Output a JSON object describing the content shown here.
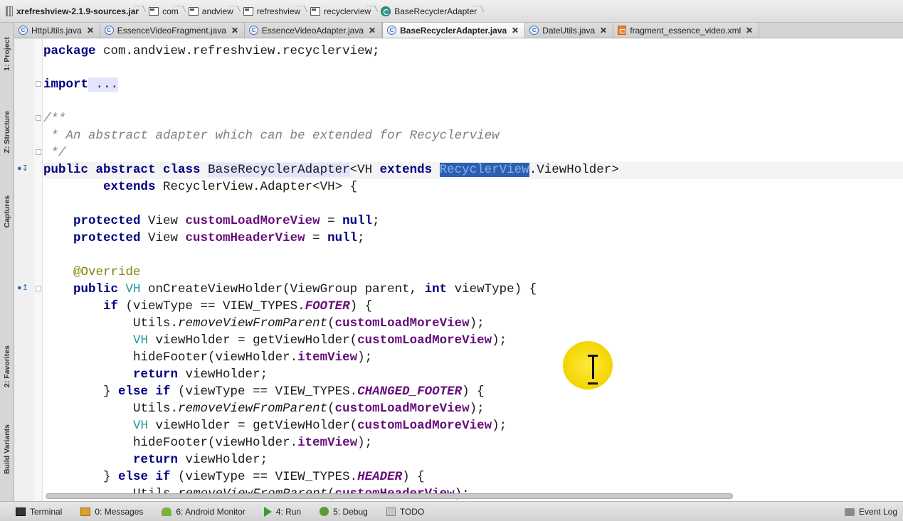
{
  "breadcrumb": [
    {
      "label": "xrefreshview-2.1.9-sources.jar",
      "icon": "jar-icon"
    },
    {
      "label": "com",
      "icon": "package-icon"
    },
    {
      "label": "andview",
      "icon": "package-icon"
    },
    {
      "label": "refreshview",
      "icon": "package-icon"
    },
    {
      "label": "recyclerview",
      "icon": "package-icon"
    },
    {
      "label": "BaseRecyclerAdapter",
      "icon": "class-icon"
    }
  ],
  "tabs": [
    {
      "label": "HttpUtils.java",
      "active": false
    },
    {
      "label": "EssenceVideoFragment.java",
      "active": false
    },
    {
      "label": "EssenceVideoAdapter.java",
      "active": false
    },
    {
      "label": "BaseRecyclerAdapter.java",
      "active": true
    },
    {
      "label": "DateUtils.java",
      "active": false
    },
    {
      "label": "fragment_essence_video.xml",
      "active": false
    }
  ],
  "left_tools": {
    "project": "1: Project",
    "structure": "Z: Structure",
    "captures": "Captures",
    "favorites": "2: Favorites",
    "build_variants": "Build Variants"
  },
  "code": {
    "l1_kw": "package",
    "l1_rest": " com.andview.refreshview.recyclerview;",
    "l2_kw": "import",
    "l2_rest": " ...",
    "l3": "/**",
    "l4": " * An abstract adapter which can be extended for Recyclerview",
    "l5": " */",
    "l6_a": "public abstract class",
    "l6_b": "BaseRecyclerAdapter",
    "l6_c": "<VH ",
    "l6_d": "extends",
    "l6_e": "RecyclerView",
    "l6_f": ".ViewHolder>",
    "l7_kw": "extends",
    "l7_rest": " RecyclerView.Adapter<VH> {",
    "l8_kw": "protected",
    "l8_t": " View ",
    "l8_f": "customLoadMoreView",
    "l8_eq": " = ",
    "l8_null": "null",
    "l9_kw": "protected",
    "l9_t": " View ",
    "l9_f": "customHeaderView",
    "l9_eq": " = ",
    "l9_null": "null",
    "semi": ";",
    "l10": "@Override",
    "l11_kw": "public",
    "l11_vh": " VH ",
    "l11_rest1": "onCreateViewHolder(ViewGroup parent, ",
    "l11_int": "int",
    "l11_rest2": " viewType) {",
    "if_kw": "if",
    "elseif_close": "} ",
    "else_kw": "else if",
    "cond_open": " (viewType == VIEW_TYPES.",
    "footer": "FOOTER",
    "changed_footer": "CHANGED_FOOTER",
    "header": "HEADER",
    "cond_close": ") {",
    "utils": "Utils.",
    "remove": "removeViewFromParent",
    "paren_open": "(",
    "paren_close": ");",
    "vh": "VH",
    "vh_rest": " viewHolder = getViewHolder(",
    "hide": "hideFooter(viewHolder.",
    "itemview": "itemView",
    "return_kw": "return",
    "return_rest": " viewHolder;"
  },
  "bottom_tools": [
    {
      "label": "Terminal",
      "icon": "terminal-icon"
    },
    {
      "label": "0: Messages",
      "icon": "messages-icon"
    },
    {
      "label": "6: Android Monitor",
      "icon": "android-icon"
    },
    {
      "label": "4: Run",
      "icon": "run-icon"
    },
    {
      "label": "5: Debug",
      "icon": "debug-icon"
    },
    {
      "label": "TODO",
      "icon": "todo-icon"
    }
  ],
  "event_log": "Event Log"
}
